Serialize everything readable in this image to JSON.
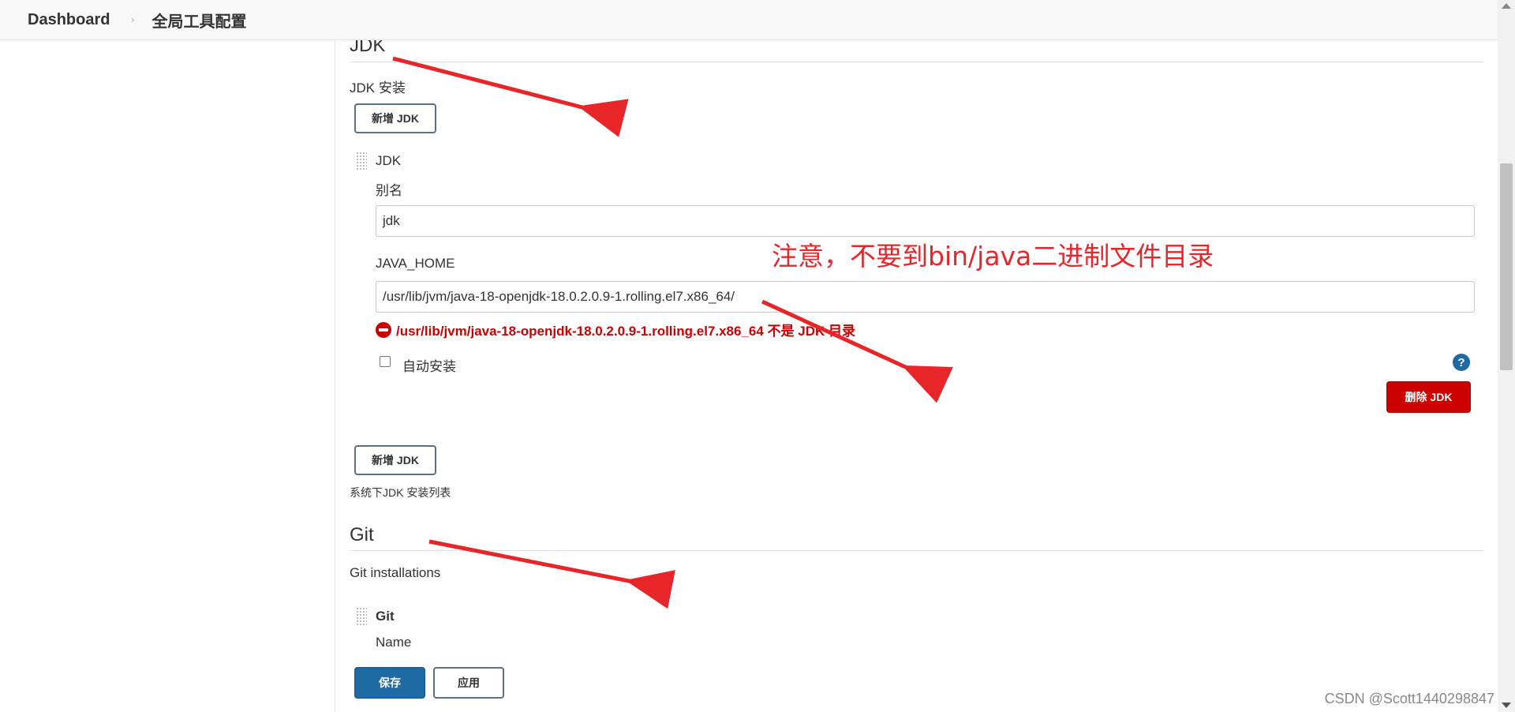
{
  "breadcrumb": {
    "home": "Dashboard",
    "separator": "›",
    "current": "全局工具配置"
  },
  "jdk_section": {
    "title": "JDK",
    "installations_label": "JDK 安装",
    "add_button": "新增 JDK",
    "item": {
      "header": "JDK",
      "alias_label": "别名",
      "alias_value": "jdk",
      "java_home_label": "JAVA_HOME",
      "java_home_value": "/usr/lib/jvm/java-18-openjdk-18.0.2.0.9-1.rolling.el7.x86_64/",
      "error_message": "/usr/lib/jvm/java-18-openjdk-18.0.2.0.9-1.rolling.el7.x86_64 不是 JDK 目录",
      "auto_install_label": "自动安装",
      "auto_install_checked": false,
      "help_glyph": "?",
      "delete_button": "删除 JDK"
    },
    "add_button_bottom": "新增 JDK",
    "description": "系统下JDK 安装列表"
  },
  "git_section": {
    "title": "Git",
    "installations_label": "Git installations",
    "item": {
      "header": "Git",
      "name_label": "Name"
    }
  },
  "footer_buttons": {
    "save": "保存",
    "apply": "应用"
  },
  "annotation_text": "注意，不要到bin/java二进制文件目录",
  "watermark": "CSDN @Scott1440298847",
  "colors": {
    "annotation_red": "#e8262a",
    "danger": "#cc0000",
    "primary": "#1d6aa5"
  },
  "icons": [
    "chevron-right-icon",
    "drag-handle-icon",
    "error-icon",
    "help-icon",
    "red-arrow"
  ]
}
